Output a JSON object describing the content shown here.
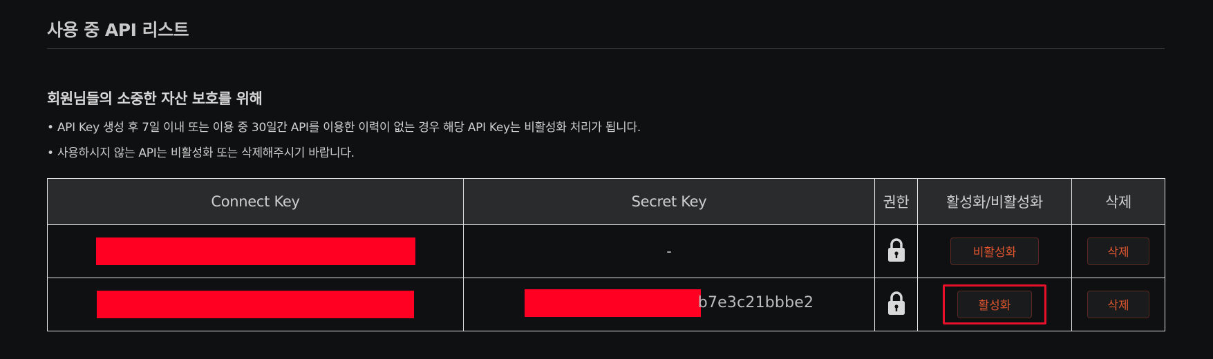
{
  "section": {
    "title": "사용 중 API 리스트"
  },
  "notice": {
    "title": "회원님들의 소중한 자산 보호를 위해",
    "lines": [
      "• API Key 생성 후 7일 이내 또는 이용 중 30일간 API를 이용한 이력이 없는 경우 해당 API Key는 비활성화 처리가 됩니다.",
      "• 사용하시지 않는 API는 비활성화 또는 삭제해주시기 바랍니다."
    ]
  },
  "table": {
    "headers": {
      "connect_key": "Connect Key",
      "secret_key": "Secret Key",
      "permission": "권한",
      "toggle": "활성화/비활성화",
      "delete": "삭제"
    },
    "rows": [
      {
        "connect_key": "",
        "secret_key": "-",
        "permission_icon": "lock-icon",
        "toggle_label": "비활성화",
        "delete_label": "삭제"
      },
      {
        "connect_key": "",
        "secret_key_visible_tail": "b7e3c21bbbe2",
        "permission_icon": "lock-icon",
        "toggle_label": "활성화",
        "delete_label": "삭제"
      }
    ]
  },
  "colors": {
    "background": "#0f1012",
    "header_bg": "#2a2b2d",
    "accent_button_text": "#e0562f",
    "redaction": "#ff0022",
    "highlight_border": "#e8102a"
  }
}
